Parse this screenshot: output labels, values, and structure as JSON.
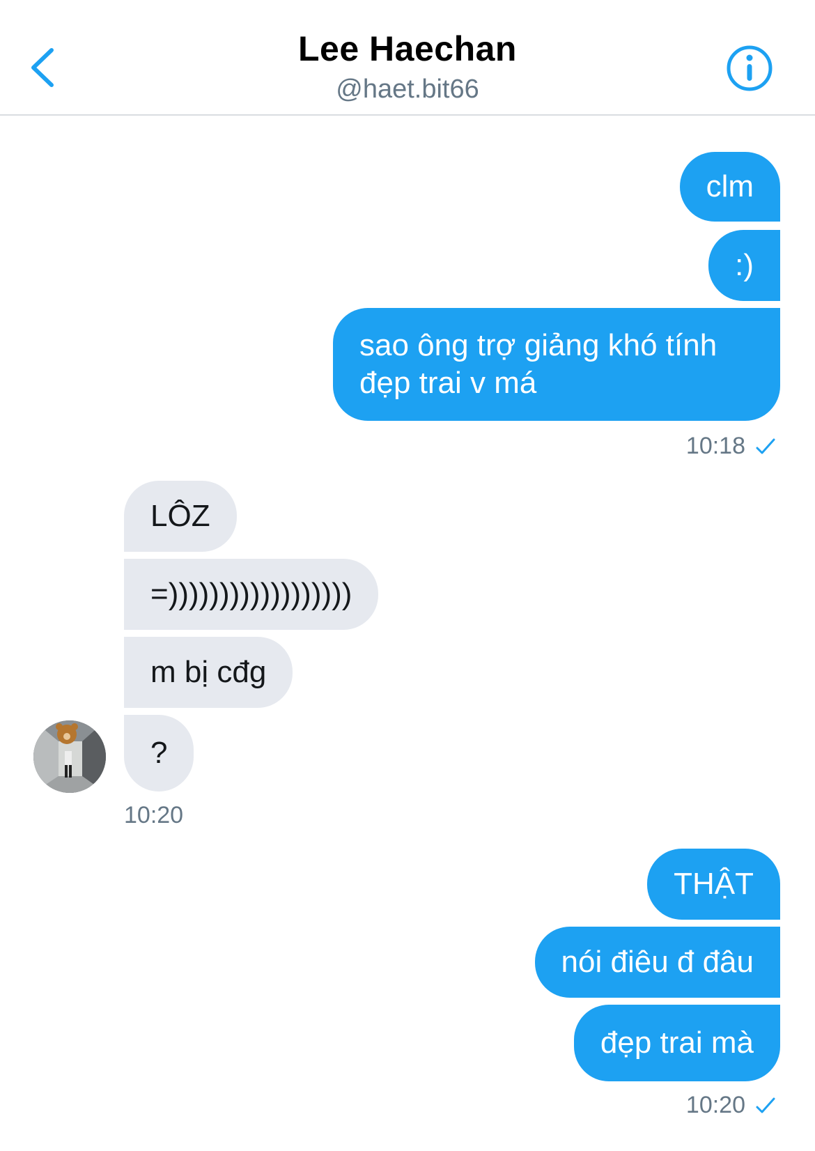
{
  "header": {
    "title": "Lee Haechan",
    "handle": "@haet.bit66",
    "back_icon": "chevron-left-icon",
    "info_icon": "info-circle-icon"
  },
  "colors": {
    "accent": "#1da1f2",
    "received_bubble": "#e6e9ef",
    "muted_text": "#657786"
  },
  "messages": {
    "group1": [
      "clm",
      ":)",
      "sao ông trợ giảng khó tính",
      "đẹp trai v má"
    ],
    "group1_time": "10:18",
    "group2": [
      "LÔZ",
      "=))))))))))))))))))",
      "m bị cđg",
      "?"
    ],
    "group2_time": "10:20",
    "group3": [
      "THẬT",
      "nói điêu đ đâu",
      "đẹp trai mà"
    ],
    "group3_time": "10:20"
  }
}
